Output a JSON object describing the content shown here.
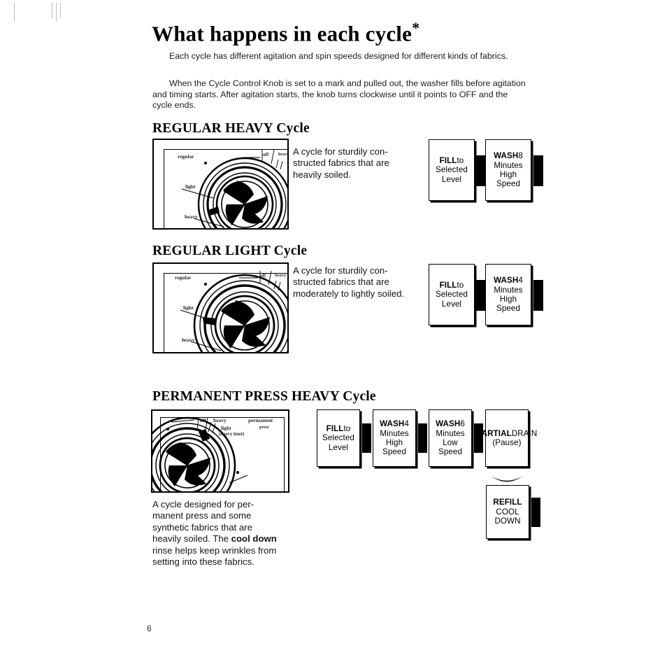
{
  "document": {
    "title": "What happens in each cycle",
    "title_marker": "*",
    "page_number": "6"
  },
  "intro": {
    "paragraph1": "Each cycle has different agitation and spin speeds designed for different kinds of fabrics.",
    "paragraph2": "When the Cycle Control Knob is set to a mark and pulled out, the washer fills before agitation and timing starts. After agitation starts, the knob turns clockwise until it points to OFF and the cycle ends."
  },
  "sections": [
    {
      "heading": "REGULAR HEAVY Cycle",
      "description": "A cycle for sturdily con-structed fabrics that are heavily soiled.",
      "knob_labels": [
        "regular",
        "off",
        "heavy",
        "light",
        "heavy"
      ],
      "steps": [
        {
          "title": "FILL",
          "lines": "to\nSelected\nLevel"
        },
        {
          "title": "WASH",
          "lines": "8\nMinutes\nHigh\nSpeed"
        }
      ]
    },
    {
      "heading": "REGULAR LIGHT Cycle",
      "description": "A cycle for sturdily con-structed fabrics that are moderately to lightly soiled.",
      "knob_labels": [
        "regular",
        "off",
        "heavy",
        "light",
        "heavy"
      ],
      "steps": [
        {
          "title": "FILL",
          "lines": "to\nSelected\nLevel"
        },
        {
          "title": "WASH",
          "lines": "4\nMinutes\nHigh\nSpeed"
        }
      ]
    },
    {
      "heading": "PERMANENT PRESS HEAVY Cycle",
      "description_parts": {
        "before_bold": "A cycle designed for per-manent press and some synthetic fabrics that are heavily soiled. The ",
        "bold": "cool down",
        "after_bold": " rinse helps keep wrinkles from setting into these fabrics."
      },
      "knob_labels": [
        "off",
        "heavy",
        "light",
        "(heavy knot)",
        "permanent",
        "press"
      ],
      "steps": [
        {
          "title": "FILL",
          "lines": "to\nSelected\nLevel"
        },
        {
          "title": "WASH",
          "lines": "4\nMinutes\nHigh\nSpeed"
        },
        {
          "title": "WASH",
          "lines": "6\nMinutes\nLow\nSpeed"
        },
        {
          "title": "PARTIAL",
          "lines": "DRAIN\n(Pause)"
        }
      ],
      "steps_row2": [
        {
          "title": "REFILL",
          "lines": "\nCOOL\nDOWN"
        }
      ]
    }
  ],
  "colors": {
    "ink": "#000000",
    "paper": "#ffffff",
    "muted": "#2a2a2a"
  }
}
